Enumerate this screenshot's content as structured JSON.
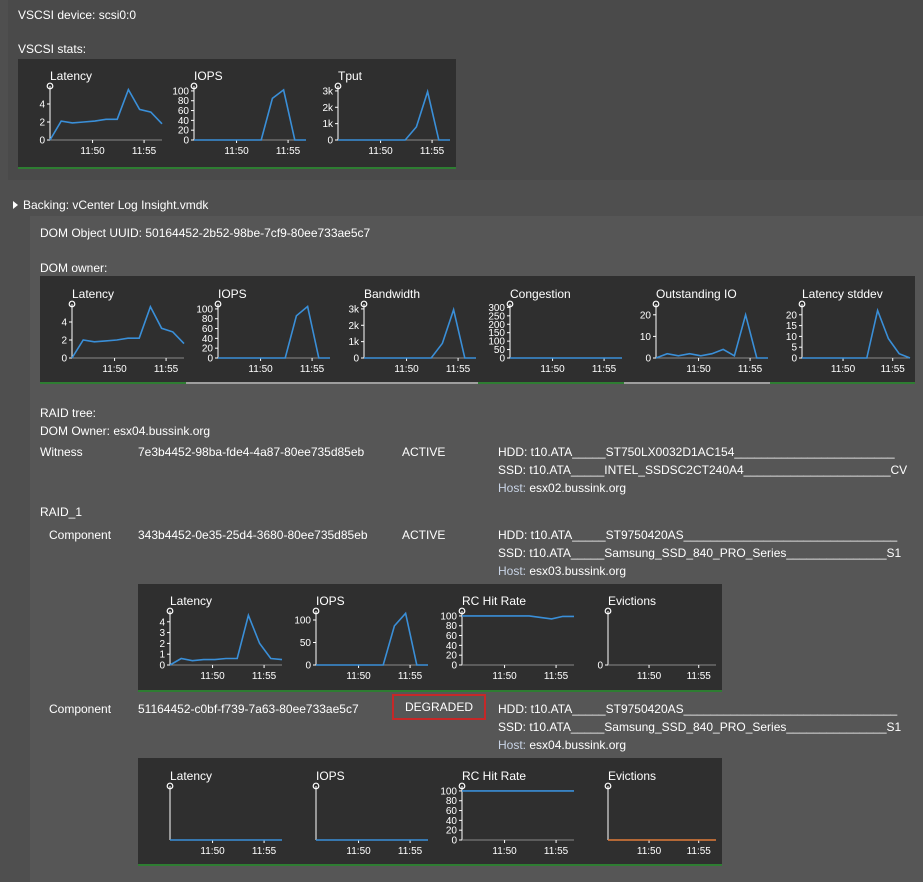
{
  "vscsi": {
    "device_label": "VSCSI device: scsi0:0",
    "stats_label": "VSCSI stats:"
  },
  "backing": {
    "label": "Backing: vCenter Log Insight.vmdk",
    "dom_uuid": "DOM Object UUID: 50164452-2b52-98be-7cf9-80ee733ae5c7",
    "dom_owner_label": "DOM owner:",
    "raid_tree_label": "RAID tree:",
    "dom_owner_host": "DOM Owner: esx04.bussink.org"
  },
  "witness": {
    "role": "Witness",
    "uuid": "7e3b4452-98ba-fde4-4a87-80ee735d85eb",
    "state": "ACTIVE",
    "hdd": "HDD: t10.ATA_____ST750LX0032D1AC154________________________",
    "ssd": "SSD: t10.ATA_____INTEL_SSDSC2CT240A4______________________CV",
    "host_label": "Host:",
    "host": "esx02.bussink.org"
  },
  "raid1_label": "RAID_1",
  "components": [
    {
      "role": "Component",
      "uuid": "343b4452-0e35-25d4-3680-80ee735d85eb",
      "state": "ACTIVE",
      "hdd": "HDD: t10.ATA_____ST9750420AS________________________________",
      "ssd": "SSD: t10.ATA_____Samsung_SSD_840_PRO_Series_______________S1",
      "host_label": "Host:",
      "host": "esx03.bussink.org"
    },
    {
      "role": "Component",
      "uuid": "51164452-c0bf-f739-7a63-80ee733ae5c7",
      "state": "DEGRADED",
      "hdd": "HDD: t10.ATA_____ST9750420AS________________________________",
      "ssd": "SSD: t10.ATA_____Samsung_SSD_840_PRO_Series_______________S1",
      "host_label": "Host:",
      "host": "esx04.bussink.org"
    }
  ],
  "colors": {
    "line": "#3a8fd8",
    "orange": "#e07b39",
    "panel": "#2f2f2f",
    "green": "#2e7d32"
  },
  "chart_data": [
    {
      "id": "vscsi-latency",
      "type": "line",
      "title": "Latency",
      "yticks": [
        "0",
        "2",
        "4"
      ],
      "ylim": [
        0,
        6
      ],
      "xticks": [
        "11:50",
        "11:55"
      ],
      "values": [
        0,
        2.1,
        1.9,
        2.0,
        2.1,
        2.3,
        2.3,
        5.6,
        3.4,
        3.1,
        1.8
      ]
    },
    {
      "id": "vscsi-iops",
      "type": "line",
      "title": "IOPS",
      "yticks": [
        "0",
        "20",
        "40",
        "60",
        "80",
        "100"
      ],
      "ylim": [
        0,
        110
      ],
      "xticks": [
        "11:50",
        "11:55"
      ],
      "values": [
        0,
        0,
        0,
        0,
        0,
        0,
        0,
        85,
        102,
        0,
        0
      ]
    },
    {
      "id": "vscsi-tput",
      "type": "line",
      "title": "Tput",
      "yticks": [
        "0",
        "1k",
        "2k",
        "3k"
      ],
      "ylim": [
        0,
        3300
      ],
      "xticks": [
        "11:50",
        "11:55"
      ],
      "values": [
        0,
        0,
        0,
        0,
        0,
        0,
        0,
        800,
        2950,
        0,
        0
      ]
    },
    {
      "id": "dom-latency",
      "type": "line",
      "title": "Latency",
      "yticks": [
        "0",
        "2",
        "4"
      ],
      "ylim": [
        0,
        6
      ],
      "xticks": [
        "11:50",
        "11:55"
      ],
      "values": [
        0,
        2.0,
        1.8,
        1.9,
        2.0,
        2.2,
        2.2,
        5.7,
        3.3,
        2.9,
        1.6
      ]
    },
    {
      "id": "dom-iops",
      "type": "line",
      "title": "IOPS",
      "yticks": [
        "0",
        "20",
        "40",
        "60",
        "80",
        "100"
      ],
      "ylim": [
        0,
        110
      ],
      "xticks": [
        "11:50",
        "11:55"
      ],
      "values": [
        0,
        0,
        0,
        0,
        0,
        0,
        0,
        86,
        105,
        0,
        0
      ]
    },
    {
      "id": "dom-bandwidth",
      "type": "line",
      "title": "Bandwidth",
      "yticks": [
        "0",
        "1k",
        "2k",
        "3k"
      ],
      "ylim": [
        0,
        3300
      ],
      "xticks": [
        "11:50",
        "11:55"
      ],
      "values": [
        0,
        0,
        0,
        0,
        0,
        0,
        0,
        900,
        2950,
        0,
        0
      ]
    },
    {
      "id": "dom-congestion",
      "type": "line",
      "title": "Congestion",
      "yticks": [
        "0",
        "50",
        "100",
        "150",
        "200",
        "250",
        "300"
      ],
      "ylim": [
        0,
        320
      ],
      "xticks": [
        "11:50",
        "11:55"
      ],
      "values": [
        0,
        0,
        0,
        0,
        0,
        0,
        0,
        0,
        0,
        0,
        0
      ]
    },
    {
      "id": "dom-outstanding",
      "type": "line",
      "title": "Outstanding IO",
      "yticks": [
        "0",
        "10",
        "20"
      ],
      "ylim": [
        0,
        25
      ],
      "xticks": [
        "11:50",
        "11:55"
      ],
      "values": [
        0,
        2,
        1,
        2,
        1,
        2,
        4,
        1,
        20,
        0,
        0
      ]
    },
    {
      "id": "dom-latency-stddev",
      "type": "line",
      "title": "Latency stddev",
      "yticks": [
        "0",
        "5",
        "10",
        "15",
        "20"
      ],
      "ylim": [
        0,
        25
      ],
      "xticks": [
        "11:50",
        "11:55"
      ],
      "values": [
        0,
        0,
        0,
        0,
        0,
        0,
        0,
        22,
        9,
        2,
        0
      ]
    },
    {
      "id": "c1-latency",
      "type": "line",
      "title": "Latency",
      "yticks": [
        "0",
        "1",
        "2",
        "3",
        "4"
      ],
      "ylim": [
        0,
        5
      ],
      "xticks": [
        "11:50",
        "11:55"
      ],
      "values": [
        0,
        0.6,
        0.4,
        0.5,
        0.5,
        0.6,
        0.6,
        4.6,
        2.0,
        0.6,
        0.5
      ]
    },
    {
      "id": "c1-iops",
      "type": "line",
      "title": "IOPS",
      "yticks": [
        "0",
        "50",
        "100"
      ],
      "ylim": [
        0,
        120
      ],
      "xticks": [
        "11:50",
        "11:55"
      ],
      "values": [
        0,
        0,
        0,
        0,
        0,
        0,
        0,
        87,
        115,
        0,
        0
      ]
    },
    {
      "id": "c1-rchit",
      "type": "line",
      "title": "RC Hit Rate",
      "yticks": [
        "0",
        "20",
        "40",
        "60",
        "80",
        "100"
      ],
      "ylim": [
        0,
        110
      ],
      "xticks": [
        "11:50",
        "11:55"
      ],
      "values": [
        100,
        100,
        100,
        100,
        100,
        100,
        100,
        97,
        94,
        99,
        99
      ]
    },
    {
      "id": "c1-evictions",
      "type": "line",
      "title": "Evictions",
      "yticks": [
        "0"
      ],
      "ylim": [
        0,
        1
      ],
      "xticks": [
        "11:50",
        "11:55"
      ],
      "values": []
    },
    {
      "id": "c2-latency",
      "type": "line",
      "title": "Latency",
      "yticks": [],
      "ylim": [
        0,
        1
      ],
      "xticks": [
        "11:50",
        "11:55"
      ],
      "values": [
        0,
        0,
        0,
        0,
        0,
        0,
        0,
        0,
        0,
        0,
        0
      ]
    },
    {
      "id": "c2-iops",
      "type": "line",
      "title": "IOPS",
      "yticks": [],
      "ylim": [
        0,
        1
      ],
      "xticks": [
        "11:50",
        "11:55"
      ],
      "values": [
        0,
        0,
        0,
        0,
        0,
        0,
        0,
        0,
        0,
        0,
        0
      ]
    },
    {
      "id": "c2-rchit",
      "type": "line",
      "title": "RC Hit Rate",
      "yticks": [
        "0",
        "20",
        "40",
        "60",
        "80",
        "100"
      ],
      "ylim": [
        0,
        110
      ],
      "xticks": [
        "11:50",
        "11:55"
      ],
      "values": [
        100,
        100,
        100,
        100,
        100,
        100,
        100,
        100,
        100,
        100,
        100
      ]
    },
    {
      "id": "c2-evictions",
      "type": "line",
      "title": "Evictions",
      "yticks": [],
      "ylim": [
        0,
        1
      ],
      "xticks": [
        "11:50",
        "11:55"
      ],
      "values": [
        0,
        0,
        0,
        0,
        0,
        0,
        0,
        0,
        0,
        0,
        0
      ],
      "color": "orange"
    }
  ]
}
